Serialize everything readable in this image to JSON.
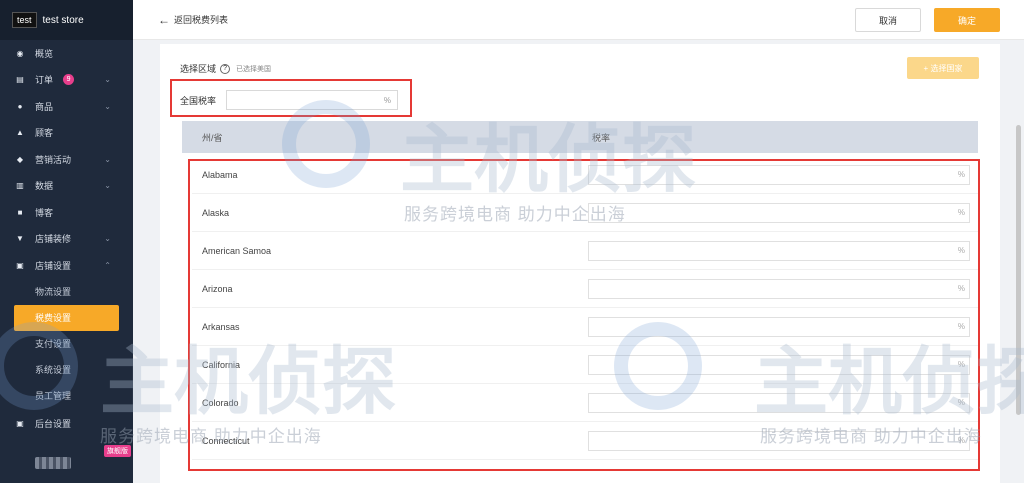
{
  "store": {
    "logo_text": "test",
    "name": "test store"
  },
  "sidebar": {
    "items": [
      {
        "label": "概览",
        "icon": "dashboard-icon",
        "glyph": "◉"
      },
      {
        "label": "订单",
        "icon": "order-icon",
        "glyph": "▤",
        "badge": "9",
        "caret": "⌄"
      },
      {
        "label": "商品",
        "icon": "product-icon",
        "glyph": "●",
        "caret": "⌄"
      },
      {
        "label": "顾客",
        "icon": "customer-icon",
        "glyph": "▲"
      },
      {
        "label": "营销活动",
        "icon": "marketing-icon",
        "glyph": "◆",
        "caret": "⌄"
      },
      {
        "label": "数据",
        "icon": "data-icon",
        "glyph": "▥",
        "caret": "⌄"
      },
      {
        "label": "博客",
        "icon": "blog-icon",
        "glyph": "■"
      },
      {
        "label": "店铺装修",
        "icon": "decoration-icon",
        "glyph": "▼",
        "caret": "⌄"
      },
      {
        "label": "店铺设置",
        "icon": "settings-icon",
        "glyph": "▣",
        "caret": "⌃"
      }
    ],
    "sub_items": [
      "物流设置",
      "税费设置",
      "支付设置",
      "系统设置",
      "员工管理"
    ],
    "backend": {
      "label": "后台设置",
      "glyph": "▣"
    },
    "plan_badge": "旗舰版"
  },
  "topbar": {
    "back_label": "返回税费列表",
    "back_glyph": "←",
    "cancel_label": "取消",
    "confirm_label": "确定"
  },
  "main": {
    "region_label": "选择区域",
    "help_glyph": "?",
    "region_selected": "已选择美国",
    "select_country_label": "+ 选择国家",
    "national_rate_label": "全国税率",
    "national_rate_unit": "%",
    "col_state": "州/省",
    "col_rate": "税率",
    "rate_unit": "%",
    "states": [
      "Alabama",
      "Alaska",
      "American Samoa",
      "Arizona",
      "Arkansas",
      "California",
      "Colorado",
      "Connecticut"
    ]
  },
  "watermark": {
    "brand": "主机侦探",
    "slogan": "服务跨境电商 助力中企出海"
  }
}
